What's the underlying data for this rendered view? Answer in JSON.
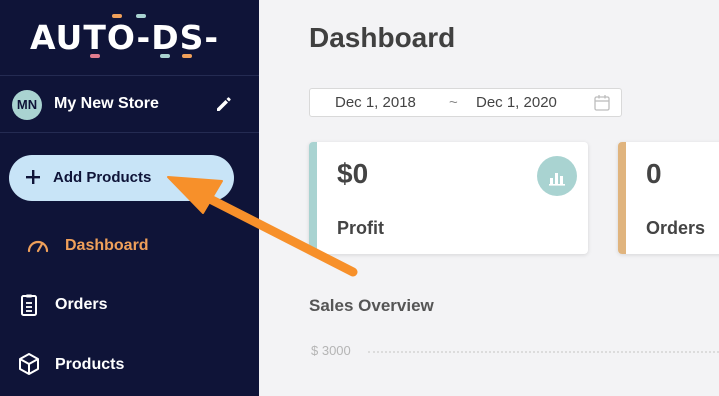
{
  "app": {
    "logo_text": "AUTO-DS-"
  },
  "store": {
    "initials": "MN",
    "name": "My New Store"
  },
  "sidebar": {
    "add_button_label": "Add Products",
    "items": [
      {
        "label": "Dashboard",
        "icon": "gauge-icon",
        "active": true
      },
      {
        "label": "Orders",
        "icon": "clipboard-icon",
        "active": false
      },
      {
        "label": "Products",
        "icon": "box-icon",
        "active": false
      }
    ]
  },
  "main": {
    "title": "Dashboard",
    "date_range": {
      "start": "Dec 1, 2018",
      "separator": "~",
      "end": "Dec 1, 2020"
    },
    "cards": [
      {
        "value": "$0",
        "label": "Profit",
        "accent": "#a9d3d1"
      },
      {
        "value": "0",
        "label": "Orders",
        "accent": "#e0b47e"
      }
    ],
    "sales_overview": {
      "title": "Sales Overview",
      "y_tick": "$ 3000"
    }
  },
  "colors": {
    "sidebar_bg": "#0f1438",
    "active_nav": "#f0a05a",
    "add_button_bg": "#c8e4f7",
    "annotation_arrow": "#f7902a"
  }
}
